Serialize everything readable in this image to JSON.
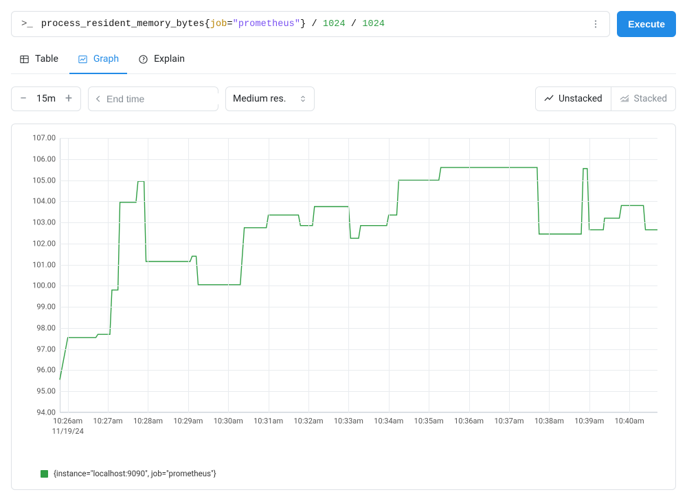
{
  "query": {
    "metric": "process_resident_memory_bytes",
    "label_key": "job",
    "label_value": "\"prometheus\"",
    "divisor": "1024"
  },
  "execute_label": "Execute",
  "tabs": {
    "table": "Table",
    "graph": "Graph",
    "explain": "Explain"
  },
  "range": {
    "value": "15m"
  },
  "endtime_placeholder": "End time",
  "resolution_label": "Medium res.",
  "stack": {
    "unstacked": "Unstacked",
    "stacked": "Stacked"
  },
  "legend_text": "{instance=\"localhost:9090\", job=\"prometheus\"}",
  "chart_data": {
    "type": "line",
    "title": "",
    "xlabel": "",
    "ylabel": "",
    "ylim": [
      94,
      107
    ],
    "x_date": "11/19/24",
    "x_ticks": [
      "10:26am",
      "10:27am",
      "10:28am",
      "10:29am",
      "10:30am",
      "10:31am",
      "10:32am",
      "10:33am",
      "10:34am",
      "10:35am",
      "10:36am",
      "10:37am",
      "10:38am",
      "10:39am",
      "10:40am"
    ],
    "y_ticks": [
      94,
      95,
      96,
      97,
      98,
      99,
      100,
      101,
      102,
      103,
      104,
      105,
      106,
      107
    ],
    "series": [
      {
        "name": "{instance=\"localhost:9090\", job=\"prometheus\"}",
        "color": "#2f9e44",
        "points": [
          {
            "t": 625.8,
            "v": 95.55
          },
          {
            "t": 626.0,
            "v": 97.55
          },
          {
            "t": 626.7,
            "v": 97.55
          },
          {
            "t": 626.75,
            "v": 97.7
          },
          {
            "t": 627.05,
            "v": 97.7
          },
          {
            "t": 627.1,
            "v": 99.8
          },
          {
            "t": 627.25,
            "v": 99.8
          },
          {
            "t": 627.3,
            "v": 103.95
          },
          {
            "t": 627.7,
            "v": 103.95
          },
          {
            "t": 627.75,
            "v": 104.95
          },
          {
            "t": 627.9,
            "v": 104.95
          },
          {
            "t": 627.95,
            "v": 101.15
          },
          {
            "t": 629.05,
            "v": 101.15
          },
          {
            "t": 629.1,
            "v": 101.4
          },
          {
            "t": 629.2,
            "v": 101.4
          },
          {
            "t": 629.25,
            "v": 100.05
          },
          {
            "t": 630.3,
            "v": 100.05
          },
          {
            "t": 630.4,
            "v": 102.75
          },
          {
            "t": 630.95,
            "v": 102.75
          },
          {
            "t": 631.0,
            "v": 103.35
          },
          {
            "t": 631.75,
            "v": 103.35
          },
          {
            "t": 631.8,
            "v": 102.85
          },
          {
            "t": 632.1,
            "v": 102.85
          },
          {
            "t": 632.15,
            "v": 103.75
          },
          {
            "t": 633.0,
            "v": 103.75
          },
          {
            "t": 633.05,
            "v": 102.25
          },
          {
            "t": 633.25,
            "v": 102.25
          },
          {
            "t": 633.3,
            "v": 102.85
          },
          {
            "t": 633.95,
            "v": 102.85
          },
          {
            "t": 634.0,
            "v": 103.35
          },
          {
            "t": 634.2,
            "v": 103.35
          },
          {
            "t": 634.25,
            "v": 105.0
          },
          {
            "t": 635.25,
            "v": 105.0
          },
          {
            "t": 635.3,
            "v": 105.6
          },
          {
            "t": 637.7,
            "v": 105.6
          },
          {
            "t": 637.75,
            "v": 102.45
          },
          {
            "t": 638.8,
            "v": 102.45
          },
          {
            "t": 638.85,
            "v": 105.55
          },
          {
            "t": 638.95,
            "v": 105.55
          },
          {
            "t": 639.0,
            "v": 102.65
          },
          {
            "t": 639.35,
            "v": 102.65
          },
          {
            "t": 639.38,
            "v": 103.2
          },
          {
            "t": 639.75,
            "v": 103.2
          },
          {
            "t": 639.8,
            "v": 103.8
          },
          {
            "t": 640.35,
            "v": 103.8
          },
          {
            "t": 640.4,
            "v": 102.65
          },
          {
            "t": 640.7,
            "v": 102.65
          }
        ]
      }
    ],
    "t_range": [
      625.8,
      640.7
    ]
  }
}
